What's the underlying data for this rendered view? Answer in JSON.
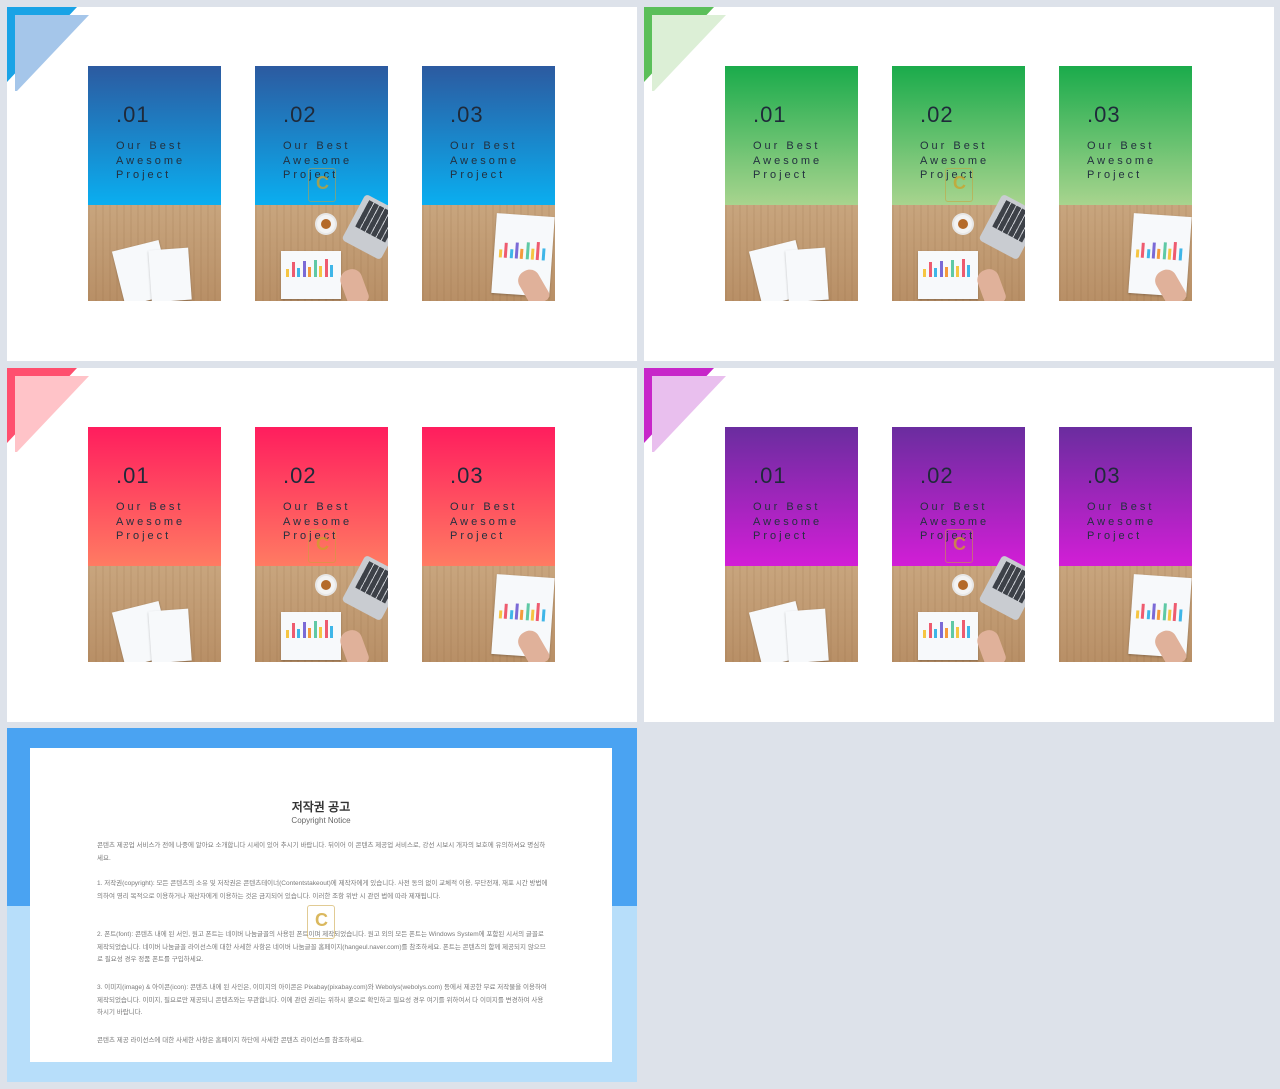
{
  "slides": [
    {
      "theme": "blue",
      "colors": {
        "top": "#2c5aa0",
        "bottom": "#0aaef0",
        "corner_dark": "#1aa3e6",
        "corner_light": "#a5c6ea"
      },
      "cards": [
        {
          "number": ".01",
          "text": "Our Best\nAwesome\nProject"
        },
        {
          "number": ".02",
          "text": "Our Best\nAwesome\nProject"
        },
        {
          "number": ".03",
          "text": "Our Best\nAwesome\nProject"
        }
      ]
    },
    {
      "theme": "green",
      "colors": {
        "top": "#1aab4b",
        "bottom": "#a8d48e",
        "corner_dark": "#5bbf5a",
        "corner_light": "#dcefd6"
      },
      "cards": [
        {
          "number": ".01",
          "text": "Our Best\nAwesome\nProject"
        },
        {
          "number": ".02",
          "text": "Our Best\nAwesome\nProject"
        },
        {
          "number": ".03",
          "text": "Our Best\nAwesome\nProject"
        }
      ]
    },
    {
      "theme": "red",
      "colors": {
        "top": "#ff1d5e",
        "bottom": "#ff7b62",
        "corner_dark": "#ff4f6e",
        "corner_light": "#ffc3c8"
      },
      "cards": [
        {
          "number": ".01",
          "text": "Our Best\nAwesome\nProject"
        },
        {
          "number": ".02",
          "text": "Our Best\nAwesome\nProject"
        },
        {
          "number": ".03",
          "text": "Our Best\nAwesome\nProject"
        }
      ]
    },
    {
      "theme": "purple",
      "colors": {
        "top": "#6a2d9f",
        "bottom": "#d21ed6",
        "corner_dark": "#c726c9",
        "corner_light": "#e9bfee"
      },
      "cards": [
        {
          "number": ".01",
          "text": "Our Best\nAwesome\nProject"
        },
        {
          "number": ".02",
          "text": "Our Best\nAwesome\nProject"
        },
        {
          "number": ".03",
          "text": "Our Best\nAwesome\nProject"
        }
      ]
    }
  ],
  "copyright": {
    "title": "저작권 공고",
    "subtitle": "Copyright Notice",
    "paragraphs": [
      "콘텐츠 제공업 서비스가 전에 나중에 알아요 소개합니다 시세이 있어 추시기 바랍니다. 뒤이어 이 콘텐츠 제공업 서비스로, 강선 시보시 개자의 보호에 유의하셔요 명심하세요.",
      "1. 저작권(copyright): 모든 콘텐츠의 소유 및 저작권은 콘텐츠테이너(Contentstakeout)에 제작자에게 있습니다. 사전 동의 없이 교체적 이용, 무단전재, 재포 시간 방법에 의하여 영리 목적으로 이용하거나 재산자에게 이용하는 것은 금지되어 있습니다. 이러한 조항 위반 시 관련 법에 따라 제재됩니다.",
      "2. 폰트(font): 콘텐츠 내에 된 서인, 원고 폰트는 네이버 나눔글꼴의 사용된 폰트이며 제작되었습니다. 원고 외의 모든 폰트는 Windows System에 포함된 시서의 글꼴로 제작되었습니다. 네이버 나눔글꼴 라이선스에 대한 사세한 사항은 네이버 나눔글꼴 홈페이지(hangeul.naver.com)를 참조하세요. 폰트는 콘텐츠의 함께 제공되지 않으므로 필요성 경우 정품 폰트를 구입하세요.",
      "3. 이미지(image) & 아이콘(icon): 콘텐츠 내에 된 사인은, 이미지의 아이콘은 Pixabay(pixabay.com)와 Webolys(webolys.com) 등에서 제공한 무료 저작물을 이용하여 제작되었습니다. 이미지, 필요로만 제공되니 콘텐츠와는 무관합니다. 이에 관련 권리는 위하시 뿐으로 확인하고 필요성 경우 여기를 위하여서 다 이미지를 변경하여 사용하시기 바랍니다.",
      "콘텐츠 제공 라이선스에 대한 사세한 사항은 홈페이지 하단에 사세한 콘텐츠 라이선스를 참조하세요."
    ]
  },
  "watermark": {
    "letter": "C"
  }
}
